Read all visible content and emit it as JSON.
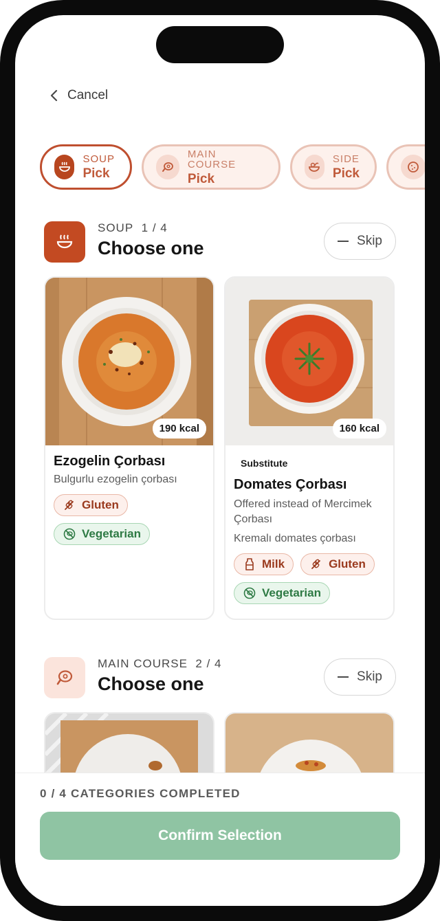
{
  "header": {
    "cancel_label": "Cancel"
  },
  "categories": [
    {
      "name": "SOUP",
      "value": "Pick",
      "icon": "soup-bowl-icon",
      "active": true
    },
    {
      "name": "MAIN COURSE",
      "value": "Pick",
      "icon": "meat-icon",
      "active": false
    },
    {
      "name": "SIDE",
      "value": "Pick",
      "icon": "salad-bowl-icon",
      "active": false
    },
    {
      "name": "",
      "value": "",
      "icon": "cookie-icon",
      "active": false
    }
  ],
  "soup_section": {
    "category": "SOUP",
    "progress": "1 / 4",
    "title": "Choose one",
    "skip_label": "Skip",
    "dishes": [
      {
        "kcal": "190 kcal",
        "name": "Ezogelin Çorbası",
        "description": "Bulgurlu ezogelin çorbası",
        "tags": [
          {
            "label": "Gluten",
            "kind": "allergen",
            "icon": "wheat-icon"
          },
          {
            "label": "Vegetarian",
            "kind": "diet",
            "icon": "no-meat-icon"
          }
        ]
      },
      {
        "kcal": "160 kcal",
        "badge": "Substitute",
        "name": "Domates Çorbası",
        "note": "Offered instead of Mercimek Çorbası",
        "description": "Kremalı domates çorbası",
        "tags": [
          {
            "label": "Milk",
            "kind": "allergen",
            "icon": "milk-bottle-icon"
          },
          {
            "label": "Gluten",
            "kind": "allergen",
            "icon": "wheat-icon"
          },
          {
            "label": "Vegetarian",
            "kind": "diet",
            "icon": "no-meat-icon"
          }
        ]
      }
    ]
  },
  "main_section": {
    "category": "MAIN COURSE",
    "progress": "2 / 4",
    "title": "Choose one",
    "skip_label": "Skip"
  },
  "footer": {
    "progress_text": "0 / 4 CATEGORIES COMPLETED",
    "confirm_label": "Confirm Selection"
  },
  "colors": {
    "brand": "#c34a22",
    "confirm_disabled": "#8fc4a3",
    "veg_tag": "#2e7a44",
    "allergen_tag": "#9a3a1e"
  }
}
